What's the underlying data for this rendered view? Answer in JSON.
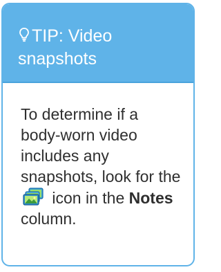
{
  "tip": {
    "title": "TIP: Video snapshots",
    "body_part1": "To determine if a body-worn video includes any snapshots, look for the",
    "body_part2": "icon in the",
    "notes_word": "Notes",
    "body_part3": "column.",
    "icons": {
      "header": "lightbulb-icon",
      "inline": "snapshots-icon"
    }
  },
  "colors": {
    "header_bg": "#5fb3e8",
    "border": "#5fb3e8",
    "header_text": "#ffffff",
    "body_text": "#2f2f2f"
  }
}
